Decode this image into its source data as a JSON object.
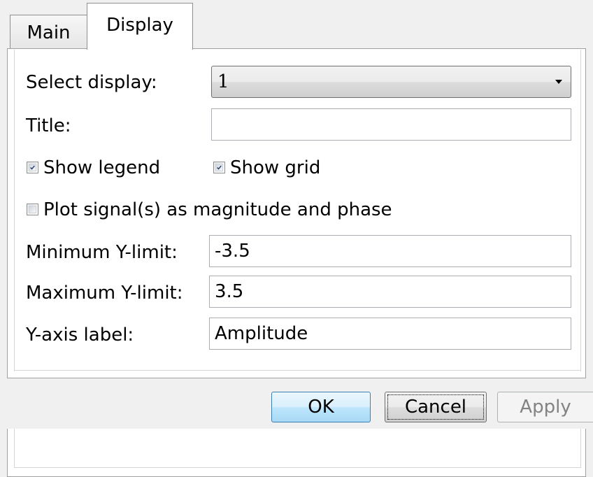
{
  "tabs": [
    {
      "label": "Main",
      "active": false
    },
    {
      "label": "Display",
      "active": true
    }
  ],
  "form": {
    "select_display_label": "Select display:",
    "select_display_value": "1",
    "title_label": "Title:",
    "title_value": "",
    "show_legend_label": "Show legend",
    "show_legend_checked": true,
    "show_grid_label": "Show grid",
    "show_grid_checked": true,
    "plot_mag_phase_label": "Plot signal(s) as magnitude and phase",
    "plot_mag_phase_checked": false,
    "min_ylimit_label": "Minimum Y-limit:",
    "min_ylimit_value": "-3.5",
    "max_ylimit_label": "Maximum Y-limit:",
    "max_ylimit_value": "3.5",
    "yaxis_label_label": "Y-axis label:",
    "yaxis_label_value": "Amplitude"
  },
  "buttons": {
    "ok": "OK",
    "cancel": "Cancel",
    "apply": "Apply"
  },
  "icons": {
    "checkbox_check": "check-icon",
    "dropdown_arrow": "chevron-down-icon"
  }
}
